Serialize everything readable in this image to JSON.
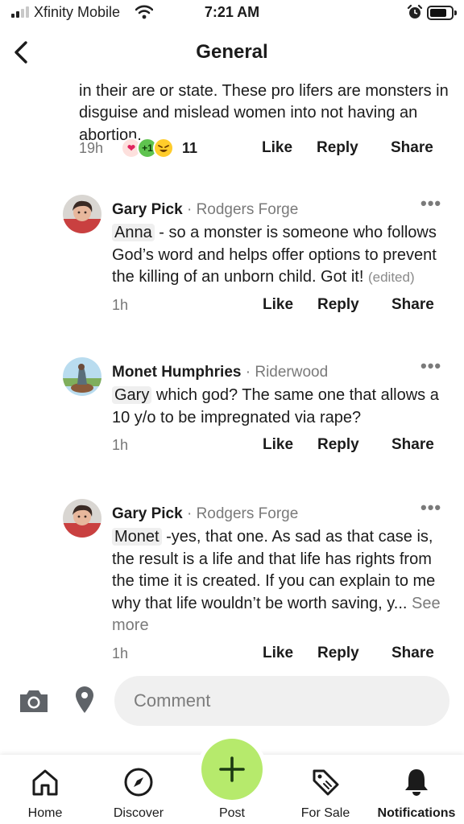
{
  "status_bar": {
    "carrier": "Xfinity Mobile",
    "time": "7:21 AM"
  },
  "header": {
    "title": "General"
  },
  "top_post": {
    "line_fragment": "... ... ... ... ... ... ... ... ... ...",
    "text": "in their are or state. These pro lifers are monsters in disguise and mislead women into not having an abortion.",
    "time": "19h",
    "reaction_count": "11",
    "reactions": [
      "heart",
      "+1",
      "laugh"
    ],
    "like": "Like",
    "reply": "Reply",
    "share": "Share"
  },
  "comments": [
    {
      "name": "Gary Pick",
      "location": "Rodgers Forge",
      "mention": "Anna",
      "text": " - so a monster is someone who follows God’s word and helps offer options to prevent the killing of an unborn child.  Got it! ",
      "edited": "(edited)",
      "time": "1h",
      "like": "Like",
      "reply": "Reply",
      "share": "Share"
    },
    {
      "name": "Monet Humphries",
      "location": "Riderwood",
      "mention": "Gary",
      "text": " which god? The same one that allows a 10 y/o to be impregnated via rape?",
      "time": "1h",
      "like": "Like",
      "reply": "Reply",
      "share": "Share"
    },
    {
      "name": "Gary Pick",
      "location": "Rodgers Forge",
      "mention": "Monet",
      "text": " -yes, that one.  As sad as that case is, the result is a life and that life has rights from the time it is created.  If you can explain to me why that life wouldn’t be worth saving, y... ",
      "see_more": "See more",
      "time": "1h",
      "like": "Like",
      "reply": "Reply",
      "share": "Share"
    }
  ],
  "composer": {
    "placeholder": "Comment"
  },
  "tabbar": {
    "home": "Home",
    "discover": "Discover",
    "post": "Post",
    "for_sale": "For Sale",
    "notifications": "Notifications"
  },
  "colors": {
    "post_button": "#b6ea6c",
    "plus_reaction": "#5fc34f",
    "muted_text": "#7a7a7a"
  }
}
